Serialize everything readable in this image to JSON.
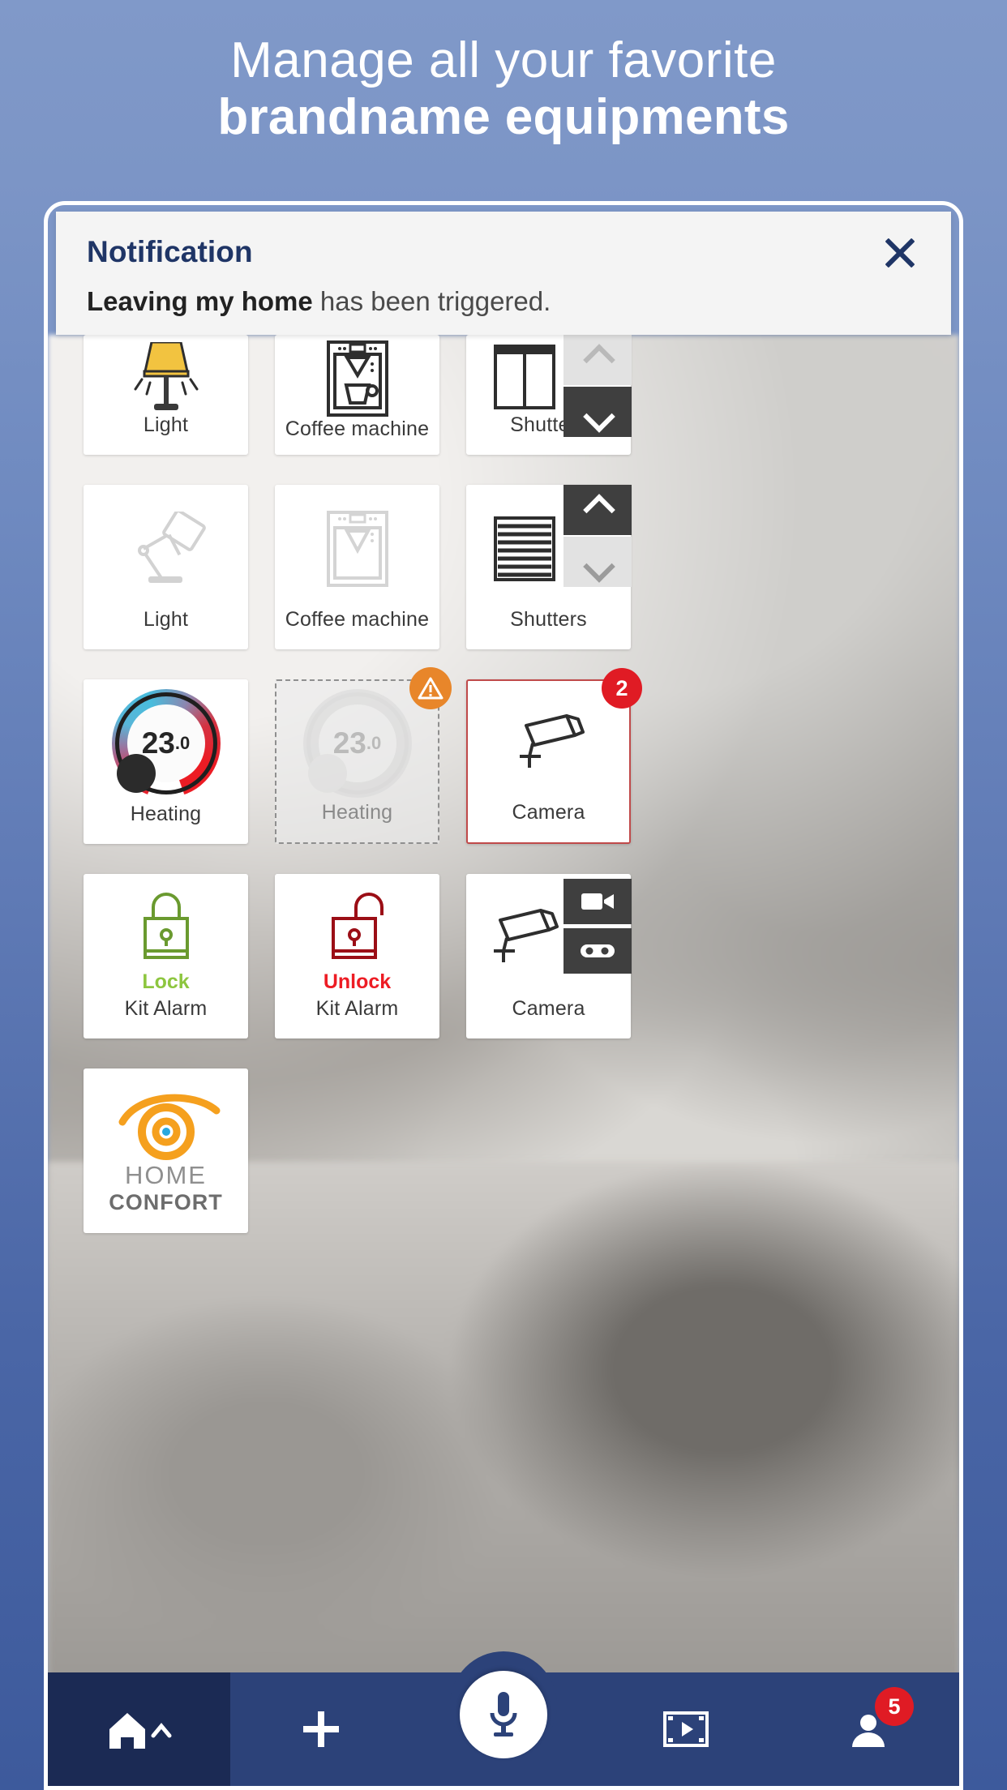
{
  "promo": {
    "line1": "Manage all your favorite",
    "line2": "brandname equipments"
  },
  "notification": {
    "title": "Notification",
    "message_bold": "Leaving my home",
    "message_rest": " has been triggered.",
    "close_icon": "close-icon"
  },
  "grid": {
    "rows": [
      {
        "cards": [
          {
            "label": "Light",
            "icon": "lamp-on-icon",
            "state": "on"
          },
          {
            "label": "Coffee machine",
            "icon": "coffee-machine-on-icon",
            "state": "on"
          },
          {
            "label": "Shutters",
            "icon": "shutters-open-icon",
            "state": "open",
            "buttons": [
              {
                "icon": "chevron-up-icon",
                "style": "light"
              },
              {
                "icon": "chevron-down-icon",
                "style": "dark"
              }
            ]
          }
        ]
      },
      {
        "cards": [
          {
            "label": "Light",
            "icon": "desk-lamp-off-icon",
            "state": "off"
          },
          {
            "label": "Coffee machine",
            "icon": "coffee-machine-off-icon",
            "state": "off"
          },
          {
            "label": "Shutters",
            "icon": "shutters-closed-icon",
            "state": "closed",
            "buttons": [
              {
                "icon": "chevron-up-icon",
                "style": "dark"
              },
              {
                "icon": "chevron-down-icon",
                "style": "light"
              }
            ]
          }
        ]
      },
      {
        "cards": [
          {
            "label": "Heating",
            "icon": "thermostat-dial-icon",
            "value": "23",
            "decimal": ".0",
            "state": "active"
          },
          {
            "label": "Heating",
            "icon": "thermostat-dial-icon",
            "value": "23",
            "decimal": ".0",
            "state": "disabled",
            "badge": "warning-icon"
          },
          {
            "label": "Camera",
            "icon": "camera-icon",
            "state": "alert",
            "badge_count": "2"
          }
        ]
      },
      {
        "cards": [
          {
            "label": "Kit Alarm",
            "state_label": "Lock",
            "icon": "padlock-closed-icon",
            "state": "locked"
          },
          {
            "label": "Kit Alarm",
            "state_label": "Unlock",
            "icon": "padlock-open-icon",
            "state": "unlocked"
          },
          {
            "label": "Camera",
            "icon": "camera-icon",
            "state": "idle",
            "buttons": [
              {
                "icon": "video-camera-icon"
              },
              {
                "icon": "tape-recorder-icon"
              }
            ]
          }
        ]
      },
      {
        "cards": [
          {
            "label": "",
            "icon": "home-confort-logo",
            "logo_line1": "HOME",
            "logo_line2": "CONFORT"
          }
        ]
      }
    ]
  },
  "bottom_nav": {
    "items": [
      {
        "icon": "home-icon",
        "name": "home",
        "active": true,
        "chevron": "chevron-up-icon"
      },
      {
        "icon": "plus-icon",
        "name": "add",
        "active": false
      },
      {
        "icon": "microphone-icon",
        "name": "voice",
        "fab": true
      },
      {
        "icon": "media-icon",
        "name": "media",
        "active": false
      },
      {
        "icon": "person-icon",
        "name": "profile",
        "active": false,
        "badge": "5"
      }
    ]
  },
  "colors": {
    "brand_navy": "#2c4279",
    "accent_orange": "#e8862a",
    "alert_red": "#e01b24",
    "lock_green": "#8dc63f",
    "unlock_red": "#ed1c24"
  }
}
